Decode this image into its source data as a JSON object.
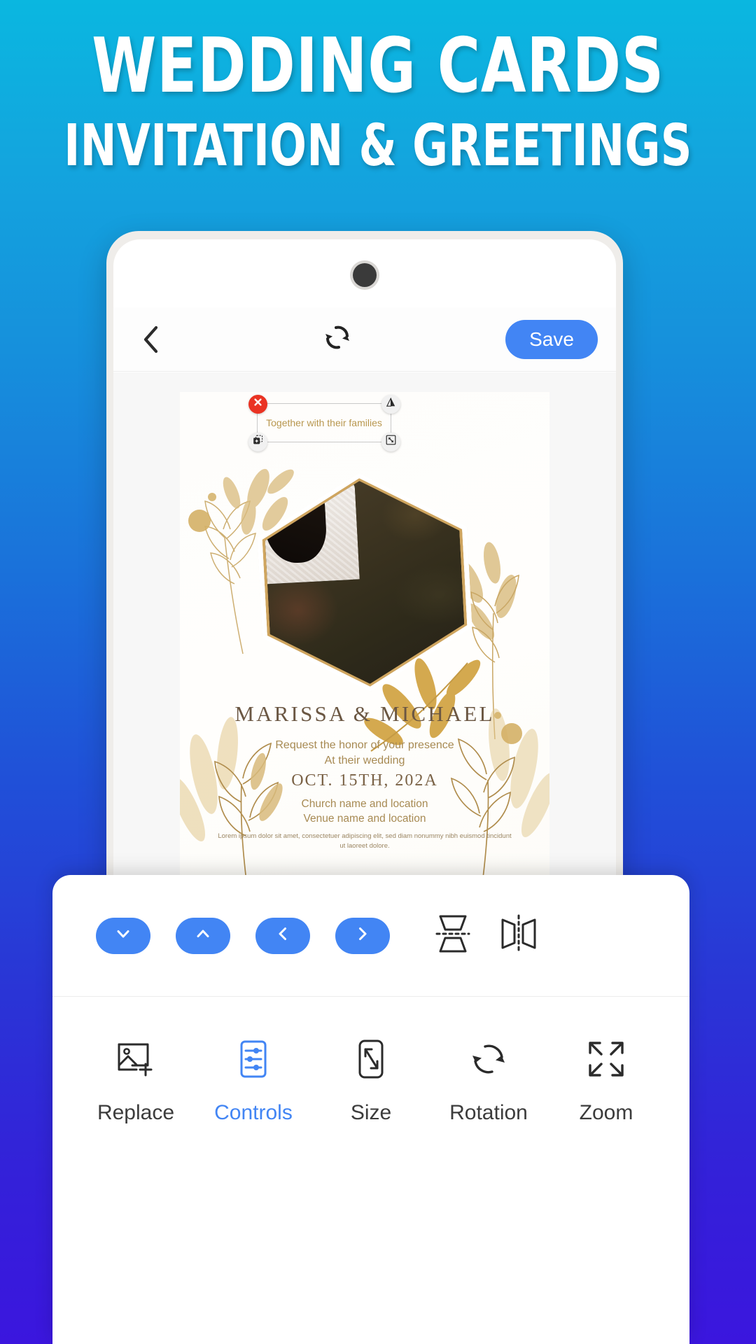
{
  "promo": {
    "title_line1": "WEDDING CARDS",
    "title_line2": "INVITATION & GREETINGS"
  },
  "colors": {
    "bg_top": "#0AB7E0",
    "bg_bottom": "#3B16DE",
    "accent_blue": "#4285F4",
    "delete_red": "#EA3323",
    "card_gold": "#B8974F"
  },
  "app": {
    "topbar": {
      "back_icon": "chevron-left-icon",
      "refresh_icon": "refresh-rotate-icon",
      "save_label": "Save"
    },
    "card": {
      "selected_text": "Together with their families",
      "names": "MARISSA & MICHAEL",
      "request_line1": "Request the honor of your presence",
      "request_line2": "At their wedding",
      "date": "OCT. 15TH, 202A",
      "venue_line1": "Church name and location",
      "venue_line2": "Venue name and location",
      "fine_print": "Lorem ipsum dolor sit amet, consectetuer adipiscing elit, sed diam nonummy nibh euismod tincidunt ut laoreet dolore.",
      "handles": [
        {
          "name": "delete-handle",
          "icon": "close-x-icon"
        },
        {
          "name": "flip-handle",
          "icon": "flip-triangle-icon"
        },
        {
          "name": "duplicate-handle",
          "icon": "duplicate-icon"
        },
        {
          "name": "resize-handle",
          "icon": "resize-diagonal-icon"
        }
      ]
    },
    "controls_panel": {
      "nudges": [
        {
          "name": "move-down-button",
          "icon": "chevron-down-icon"
        },
        {
          "name": "move-up-button",
          "icon": "chevron-up-icon"
        },
        {
          "name": "move-left-button",
          "icon": "chevron-left-icon"
        },
        {
          "name": "move-right-button",
          "icon": "chevron-right-icon"
        }
      ],
      "flips": [
        {
          "name": "flip-vertical-button",
          "icon": "flip-vertical-icon"
        },
        {
          "name": "flip-horizontal-button",
          "icon": "flip-horizontal-icon"
        }
      ]
    },
    "tabs": [
      {
        "label": "Replace",
        "icon": "add-image-icon",
        "active": false
      },
      {
        "label": "Controls",
        "icon": "sliders-icon",
        "active": true
      },
      {
        "label": "Size",
        "icon": "resize-diagonal-icon",
        "active": false
      },
      {
        "label": "Rotation",
        "icon": "rotate-icon",
        "active": false
      },
      {
        "label": "Zoom",
        "icon": "expand-arrows-icon",
        "active": false
      }
    ]
  }
}
